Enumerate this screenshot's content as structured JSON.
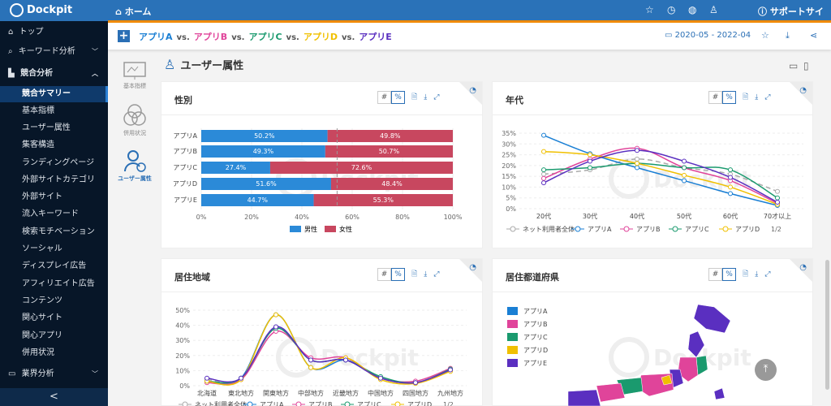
{
  "header": {
    "brand": "Dockpit",
    "home": "ホーム",
    "support": "サポートサイト"
  },
  "sidebar": {
    "items": [
      {
        "label": "トップ"
      },
      {
        "label": "キーワード分析"
      },
      {
        "label": "競合分析"
      },
      {
        "label": "競合サマリー"
      },
      {
        "label": "基本指標"
      },
      {
        "label": "ユーザー属性"
      },
      {
        "label": "集客構造"
      },
      {
        "label": "ランディングページ"
      },
      {
        "label": "外部サイトカテゴリ"
      },
      {
        "label": "外部サイト"
      },
      {
        "label": "流入キーワード"
      },
      {
        "label": "検索モチベーション"
      },
      {
        "label": "ソーシャル"
      },
      {
        "label": "ディスプレイ広告"
      },
      {
        "label": "アフィリエイト広告"
      },
      {
        "label": "コンテンツ"
      },
      {
        "label": "関心サイト"
      },
      {
        "label": "関心アプリ"
      },
      {
        "label": "併用状況"
      },
      {
        "label": "業界分析"
      }
    ],
    "collapse": "<"
  },
  "compare": {
    "apps": [
      "アプリA",
      "アプリB",
      "アプリC",
      "アプリD",
      "アプリE"
    ],
    "vs": "vs.",
    "date_range": "2020-05 - 2022-04"
  },
  "colors": {
    "A": "#1a7fd4",
    "B": "#e0449a",
    "C": "#1a9a6e",
    "D": "#f0c000",
    "E": "#5a2fc0",
    "all": "#aaaaaa"
  },
  "left_nav": {
    "items": [
      "基本指標",
      "併用状況",
      "ユーザー属性"
    ]
  },
  "section_title": "ユーザー属性",
  "toggle": {
    "count": "#",
    "percent": "%"
  },
  "chart_data": [
    {
      "type": "bar",
      "title": "性別",
      "categories": [
        "アプリA",
        "アプリB",
        "アプリC",
        "アプリD",
        "アプリE"
      ],
      "series": [
        {
          "name": "男性",
          "values": [
            50.2,
            49.3,
            27.4,
            51.6,
            44.7
          ],
          "labels": [
            "50.2%",
            "49.3%",
            "27.4%",
            "51.6%",
            "44.7%"
          ]
        },
        {
          "name": "女性",
          "values": [
            49.8,
            50.7,
            72.6,
            48.4,
            55.3
          ],
          "labels": [
            "49.8%",
            "50.7%",
            "72.6%",
            "48.4%",
            "55.3%"
          ]
        }
      ],
      "reference_line": 54,
      "xticks": [
        "0%",
        "20%",
        "40%",
        "60%",
        "80%",
        "100%"
      ],
      "xlim": [
        0,
        100
      ]
    },
    {
      "type": "line",
      "title": "年代",
      "categories": [
        "20代",
        "30代",
        "40代",
        "50代",
        "60代",
        "70才以上"
      ],
      "yticks": [
        "0%",
        "5%",
        "10%",
        "15%",
        "20%",
        "25%",
        "30%",
        "35%"
      ],
      "ylim": [
        0,
        35
      ],
      "series": [
        {
          "name": "ネット利用者全体",
          "key": "all",
          "values": [
            16,
            18,
            23,
            19,
            16,
            8
          ]
        },
        {
          "name": "アプリA",
          "key": "A",
          "values": [
            34,
            25.5,
            19,
            13,
            7,
            1.5
          ]
        },
        {
          "name": "アプリB",
          "key": "B",
          "values": [
            14,
            23,
            28,
            19,
            13,
            2.5
          ]
        },
        {
          "name": "アプリC",
          "key": "C",
          "values": [
            18,
            19,
            21,
            19,
            18,
            5
          ]
        },
        {
          "name": "アプリD",
          "key": "D",
          "values": [
            26.5,
            25,
            21,
            15.5,
            10,
            2
          ]
        },
        {
          "name": "アプリE",
          "key": "E",
          "values": [
            12,
            22,
            27,
            22,
            14.5,
            3
          ]
        }
      ],
      "legend_page": "1/2"
    },
    {
      "type": "line",
      "title": "居住地域",
      "categories": [
        "北海道",
        "東北地方",
        "関東地方",
        "中部地方",
        "近畿地方",
        "中国地方",
        "四国地方",
        "九州地方"
      ],
      "yticks": [
        "0%",
        "10%",
        "20%",
        "30%",
        "40%",
        "50%"
      ],
      "ylim": [
        0,
        50
      ],
      "series": [
        {
          "name": "ネット利用者全体",
          "key": "all",
          "values": [
            4,
            5,
            39,
            17,
            17,
            5,
            2,
            11
          ]
        },
        {
          "name": "アプリA",
          "key": "A",
          "values": [
            3,
            5,
            47,
            12,
            17,
            5,
            2,
            10
          ]
        },
        {
          "name": "アプリB",
          "key": "B",
          "values": [
            2,
            4,
            36,
            18.5,
            18.5,
            5,
            3,
            11.5
          ]
        },
        {
          "name": "アプリC",
          "key": "C",
          "values": [
            3,
            5,
            38,
            17,
            17,
            6,
            2,
            11
          ]
        },
        {
          "name": "アプリD",
          "key": "D",
          "values": [
            3,
            4,
            47,
            12,
            18.5,
            4,
            1.5,
            9.5
          ]
        },
        {
          "name": "アプリE",
          "key": "E",
          "values": [
            5,
            5,
            39,
            17,
            17,
            5,
            2,
            10.5
          ]
        }
      ],
      "legend_page": "1/2"
    }
  ],
  "prefecture": {
    "title": "居住都道府県",
    "legend": [
      "アプリA",
      "アプリB",
      "アプリC",
      "アプリD",
      "アプリE"
    ]
  }
}
